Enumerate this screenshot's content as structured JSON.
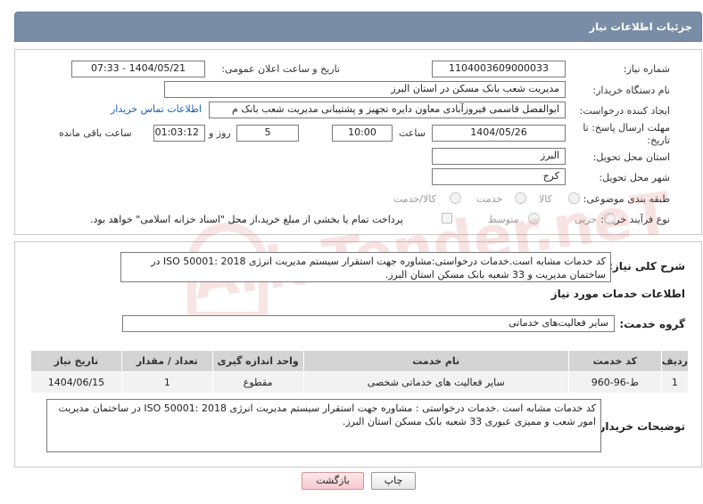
{
  "header": {
    "title": "جزئیات اطلاعات نیاز"
  },
  "need_number": {
    "label": "شماره نیاز:",
    "value": "1104003609000033"
  },
  "announce": {
    "label": "تاریخ و ساعت اعلان عمومی:",
    "value": "1404/05/21 - 07:33"
  },
  "buyer_org": {
    "label": "نام دستگاه خریدار:",
    "value": "مدیریت شعب بانک مسکن در استان البرز"
  },
  "requester": {
    "label": "ایجاد کننده درخواست:",
    "value": "ابوالفضل قاسمی فیروزآبادی معاون دایره تجهیز و پشتیبانی مدیریت شعب بانک م",
    "contact_link": "اطلاعات تماس خریدار"
  },
  "deadline": {
    "label": "مهلت ارسال پاسخ: تا تاریخ:",
    "date": "1404/05/26",
    "time_label": "ساعت",
    "time": "10:00",
    "days": "5",
    "days_label": "روز و",
    "remaining": "01:03:12",
    "remaining_label": "ساعت باقی مانده"
  },
  "province": {
    "label": "استان محل تحویل:",
    "value": "البرز"
  },
  "city": {
    "label": "شهر محل تحویل:",
    "value": "کرج"
  },
  "category": {
    "label": "طبقه بندی موضوعی:",
    "options": [
      "کالا",
      "خدمت",
      "کالا/خدمت"
    ]
  },
  "purchase_type": {
    "label": "نوع فرآیند خرید :",
    "options": [
      "جزیی",
      "متوسط"
    ],
    "payment_note": "پرداخت تمام یا بخشی از مبلغ خرید،از محل \"اسناد خزانه اسلامی\" خواهد بود."
  },
  "summary": {
    "label": "شرح کلی نیاز:",
    "text": "کد خدمات مشابه است.خدمات درخواستی:مشاوره جهت استقرار سیستم مدیریت انرژی 2018 :50001 ISO در ساختمان مدیریت و 33 شعبه بانک مسکن استان البرز."
  },
  "services_info": {
    "title": "اطلاعات خدمات مورد نیاز"
  },
  "service_group": {
    "label": "گروه خدمت:",
    "value": "سایر فعالیت‌های خدماتی"
  },
  "table": {
    "headers": [
      "ردیف",
      "کد خدمت",
      "نام خدمت",
      "واحد اندازه گیری",
      "تعداد / مقدار",
      "تاریخ نیاز"
    ],
    "rows": [
      [
        "1",
        "ط-96-960",
        "سایر فعالیت های خدماتی شخصی",
        "مقطوع",
        "1",
        "1404/06/15"
      ]
    ]
  },
  "buyer_notes": {
    "label": "توضیحات خریدار:",
    "text": "کد خدمات مشابه است .خدمات درخواستی : مشاوره جهت استقرار سیستم مدیریت انرژی 2018 :50001 ISO در ساختمان مدیریت امور شعب و ممیزی عبوری 33 شعبه بانک مسکن استان البرز."
  },
  "buttons": {
    "print": "چاپ",
    "back": "بازگشت"
  },
  "watermark": "AriaTender.neT"
}
